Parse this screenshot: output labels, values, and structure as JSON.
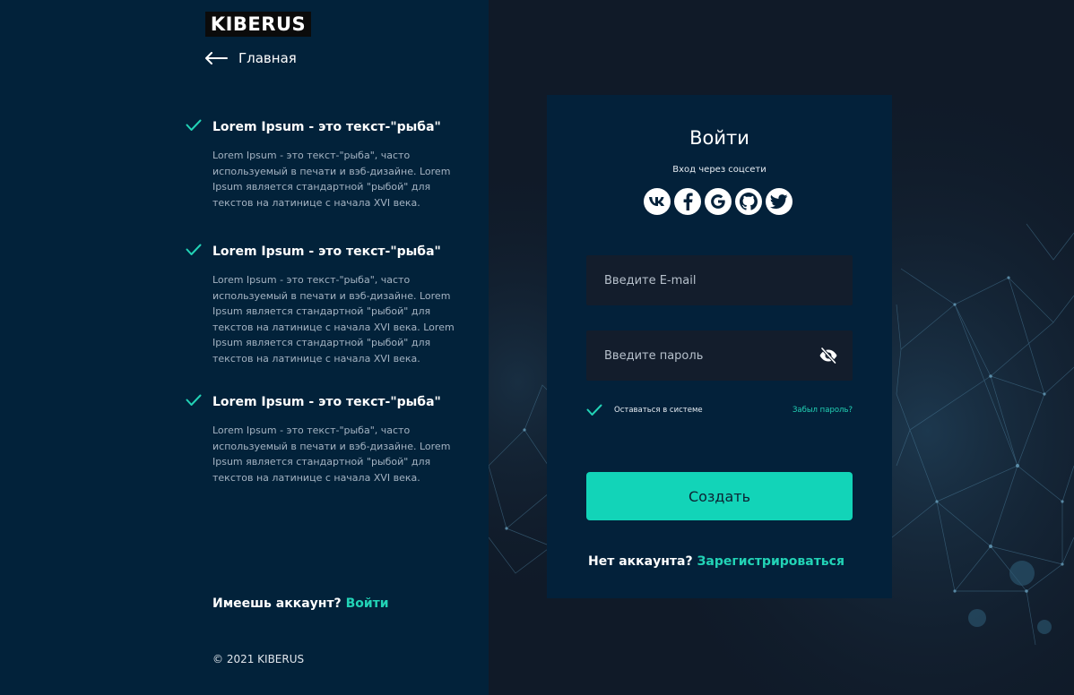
{
  "brand": {
    "logo_text": "KIBERUS"
  },
  "nav": {
    "back_label": "Главная"
  },
  "features": [
    {
      "title": "Lorem Ipsum - это текст-\"рыба\"",
      "text": "Lorem Ipsum - это текст-\"рыба\", часто используемый в печати и вэб-дизайне. Lorem Ipsum является стандартной \"рыбой\" для текстов на латинице с начала XVI века."
    },
    {
      "title": "Lorem Ipsum - это текст-\"рыба\"",
      "text": "Lorem Ipsum - это текст-\"рыба\", часто используемый в печати и вэб-дизайне. Lorem Ipsum является стандартной \"рыбой\" для текстов на латинице с начала XVI века.  Lorem Ipsum является стандартной \"рыбой\" для текстов на латинице с начала XVI века."
    },
    {
      "title": "Lorem Ipsum - это текст-\"рыба\"",
      "text": "Lorem Ipsum - это текст-\"рыба\", часто используемый в печати и вэб-дизайне. Lorem Ipsum является стандартной \"рыбой\" для текстов на латинице с начала XVI века."
    }
  ],
  "footer_left": {
    "have_account_text": "Имеешь аккаунт?",
    "login_link": "Войти",
    "copyright": "© 2021 KIBERUS"
  },
  "login_form": {
    "title": "Войти",
    "social_caption": "Вход через соцсети",
    "social_icons": [
      "vk-icon",
      "facebook-icon",
      "google-icon",
      "github-icon",
      "twitter-icon"
    ],
    "email_placeholder": "Введите E-mail",
    "password_placeholder": "Введите пароль",
    "remember_label": "Оставаться в системе",
    "remember_checked": true,
    "forgot_link": "Забыл пароль?",
    "submit_label": "Создать",
    "no_account_text": "Нет аккаунта?",
    "register_link": "Зарегистрироваться"
  },
  "colors": {
    "accent": "#12d4b8",
    "left_panel_bg": "#02223a",
    "card_bg": "#03213a",
    "input_bg": "#131d2c"
  }
}
